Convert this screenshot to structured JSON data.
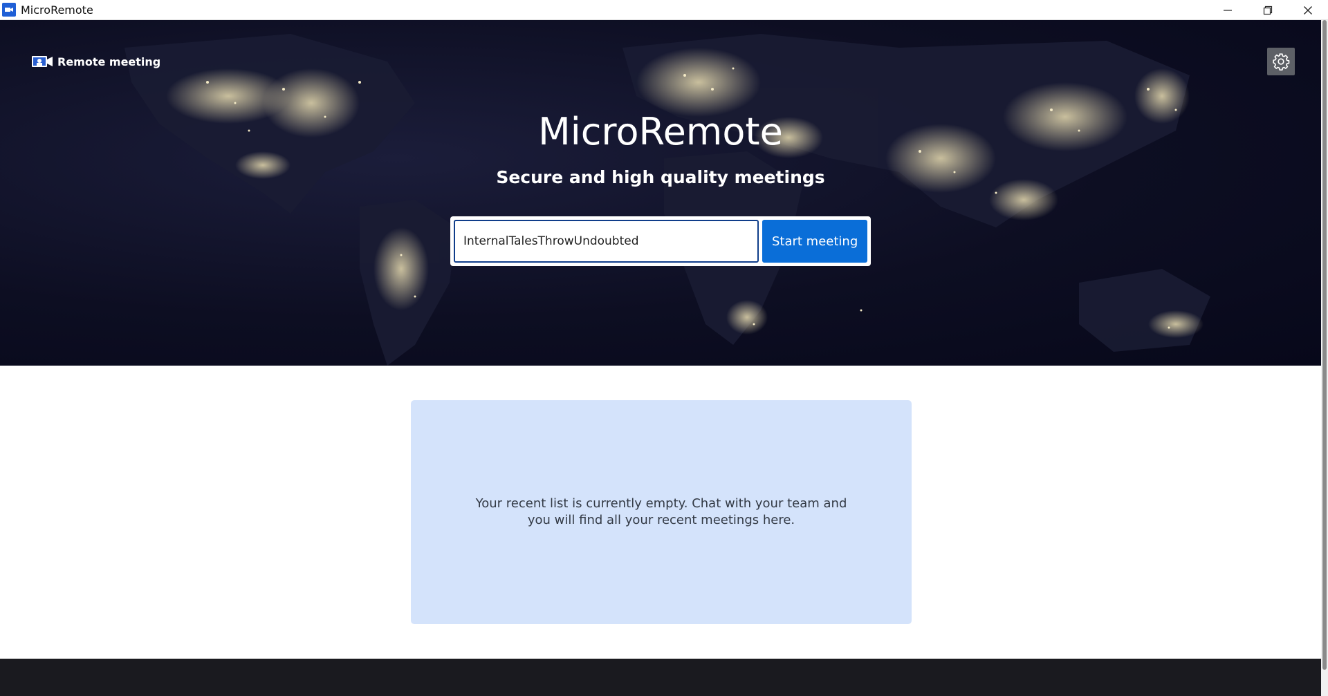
{
  "window": {
    "title": "MicroRemote",
    "icons": {
      "app": "video-camera-icon",
      "minimize": "minimize-icon",
      "maximize": "restore-icon",
      "close": "close-icon"
    }
  },
  "header": {
    "brand_label": "Remote meeting",
    "brand_icon": "video-camera-icon",
    "settings_icon": "gear-icon"
  },
  "hero": {
    "title": "MicroRemote",
    "subtitle": "Secure and high quality meetings",
    "background": "earth-night-lights"
  },
  "meeting_form": {
    "room_name_value": "InternalTalesThrowUndoubted",
    "start_button_label": "Start meeting"
  },
  "recent": {
    "empty_message": "Your recent list is currently empty. Chat with your team and you will find all your recent meetings here."
  },
  "colors": {
    "accent": "#0a6ed8",
    "panel": "#d4e3fb",
    "footer": "#1a1a1f",
    "hero_bg": "#0d0e22"
  }
}
